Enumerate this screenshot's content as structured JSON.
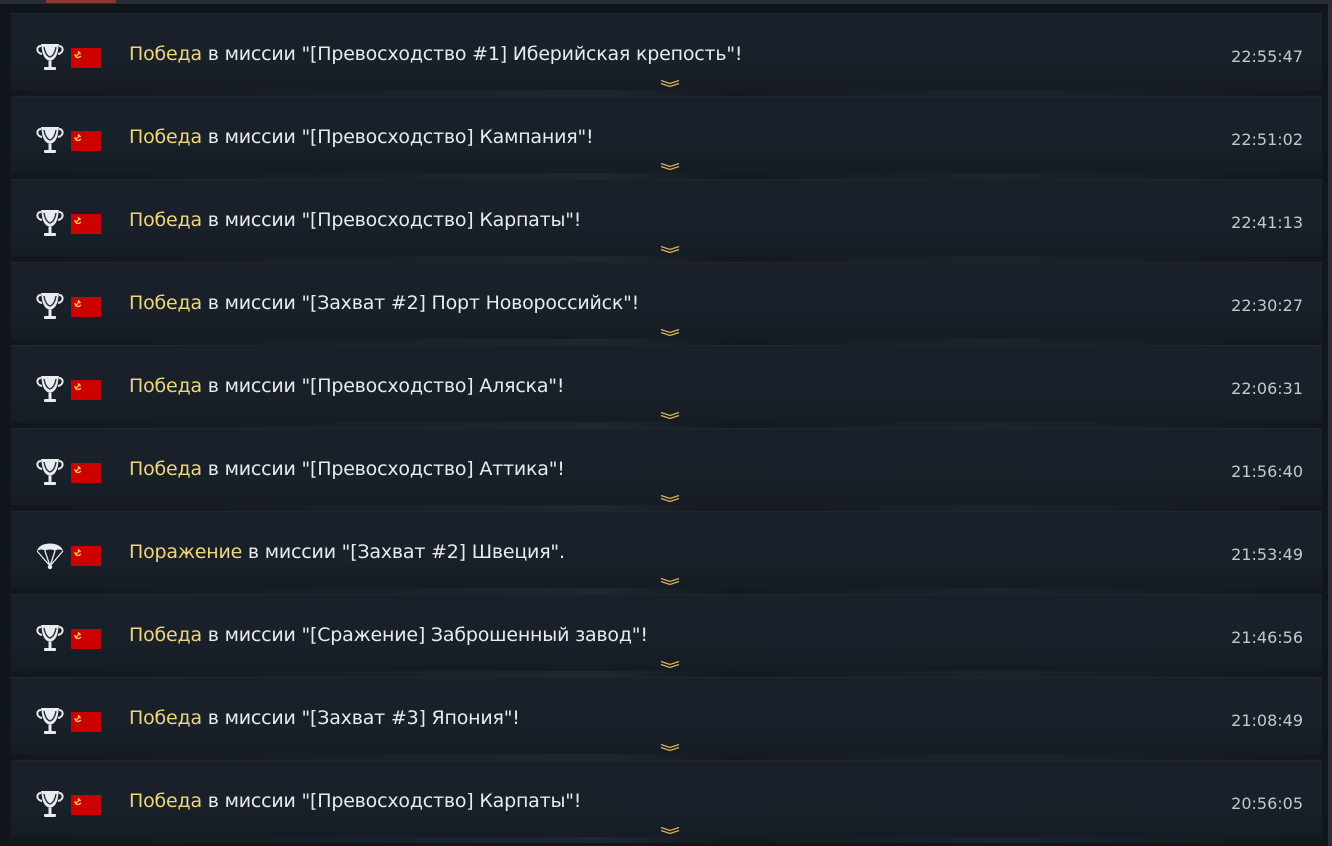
{
  "colors": {
    "background": "#11161c",
    "row_background": "#1a2029",
    "result_word": "#f1d47c",
    "message_text": "#e8eaed",
    "time_text": "#c3c8ce",
    "flag_red": "#cc0000",
    "chevron": "#d8b45a"
  },
  "events": [
    {
      "icon": "trophy-icon",
      "flag": "ussr-flag-icon",
      "result": "Победа",
      "text": " в миссии \"[Превосходство #1] Иберийская крепость\"!",
      "time": "22:55:47"
    },
    {
      "icon": "trophy-icon",
      "flag": "ussr-flag-icon",
      "result": "Победа",
      "text": " в миссии \"[Превосходство] Кампания\"!",
      "time": "22:51:02"
    },
    {
      "icon": "trophy-icon",
      "flag": "ussr-flag-icon",
      "result": "Победа",
      "text": " в миссии \"[Превосходство] Карпаты\"!",
      "time": "22:41:13"
    },
    {
      "icon": "trophy-icon",
      "flag": "ussr-flag-icon",
      "result": "Победа",
      "text": " в миссии \"[Захват #2] Порт Новороссийск\"!",
      "time": "22:30:27"
    },
    {
      "icon": "trophy-icon",
      "flag": "ussr-flag-icon",
      "result": "Победа",
      "text": " в миссии \"[Превосходство] Аляска\"!",
      "time": "22:06:31"
    },
    {
      "icon": "trophy-icon",
      "flag": "ussr-flag-icon",
      "result": "Победа",
      "text": " в миссии \"[Превосходство] Аттика\"!",
      "time": "21:56:40"
    },
    {
      "icon": "parachute-icon",
      "flag": "ussr-flag-icon",
      "result": "Поражение",
      "text": " в миссии \"[Захват #2] Швеция\".",
      "time": "21:53:49"
    },
    {
      "icon": "trophy-icon",
      "flag": "ussr-flag-icon",
      "result": "Победа",
      "text": " в миссии \"[Сражение] Заброшенный завод\"!",
      "time": "21:46:56"
    },
    {
      "icon": "trophy-icon",
      "flag": "ussr-flag-icon",
      "result": "Победа",
      "text": " в миссии \"[Захват #3] Япония\"!",
      "time": "21:08:49"
    },
    {
      "icon": "trophy-icon",
      "flag": "ussr-flag-icon",
      "result": "Победа",
      "text": " в миссии \"[Превосходство] Карпаты\"!",
      "time": "20:56:05"
    }
  ]
}
